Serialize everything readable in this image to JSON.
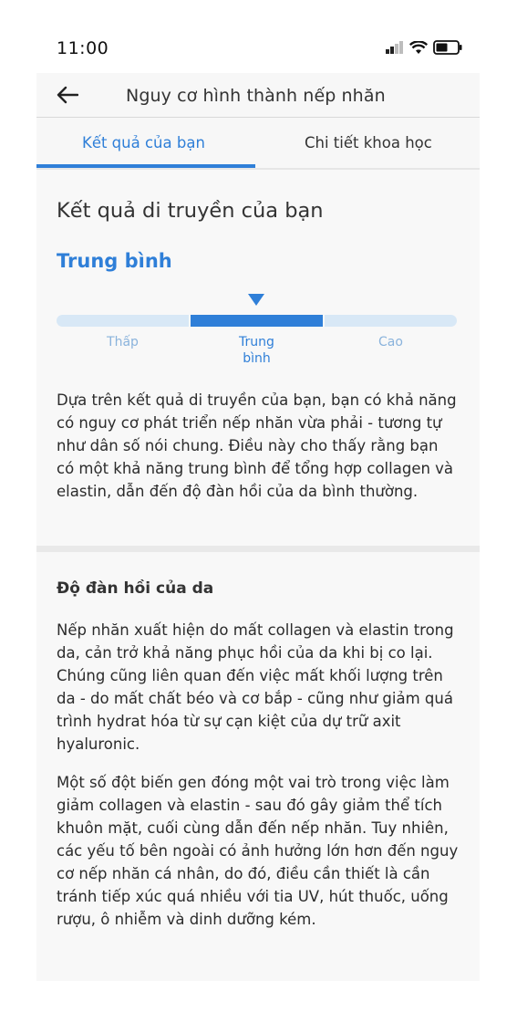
{
  "status_bar": {
    "time": "11:00"
  },
  "header": {
    "title": "Nguy cơ hình thành nếp nhăn",
    "back_icon": "arrow-left-icon"
  },
  "tabs": [
    {
      "label": "Kết quả của bạn",
      "active": true
    },
    {
      "label": "Chi tiết khoa học",
      "active": false
    }
  ],
  "result": {
    "heading": "Kết quả di truyền của bạn",
    "level": "Trung bình",
    "scale": {
      "labels": [
        "Thấp",
        "Trung bình",
        "Cao"
      ],
      "selected_index": 1
    },
    "description": "Dựa trên kết quả di truyền của bạn, bạn có khả năng có nguy cơ phát triển nếp nhăn vừa phải - tương tự như dân số nói chung. Điều này cho thấy rằng bạn có một khả năng trung bình để tổng hợp collagen và elastin, dẫn đến độ đàn hồi của da bình thường."
  },
  "details": {
    "heading": "Độ đàn hồi của da",
    "paragraphs": [
      "Nếp nhăn xuất hiện do mất collagen và elastin trong da, cản trở khả năng phục hồi của da khi bị co lại. Chúng cũng liên quan đến việc mất khối lượng trên da - do mất chất béo và cơ bắp - cũng như giảm quá trình hydrat hóa từ sự cạn kiệt của dự trữ axit hyaluronic.",
      "Một số đột biến gen đóng một vai trò trong việc làm giảm collagen và elastin - sau đó gây giảm thể tích khuôn mặt, cuối cùng dẫn đến nếp nhăn. Tuy nhiên, các yếu tố bên ngoài có ảnh hưởng lớn hơn đến nguy cơ nếp nhăn cá nhân, do đó, điều cần thiết là cần tránh tiếp xúc quá nhiều với tia UV, hút thuốc, uống rượu, ô nhiễm và dinh dưỡng kém."
    ]
  },
  "colors": {
    "accent": "#2f7fd8",
    "scale_inactive": "#d8e8f6"
  }
}
